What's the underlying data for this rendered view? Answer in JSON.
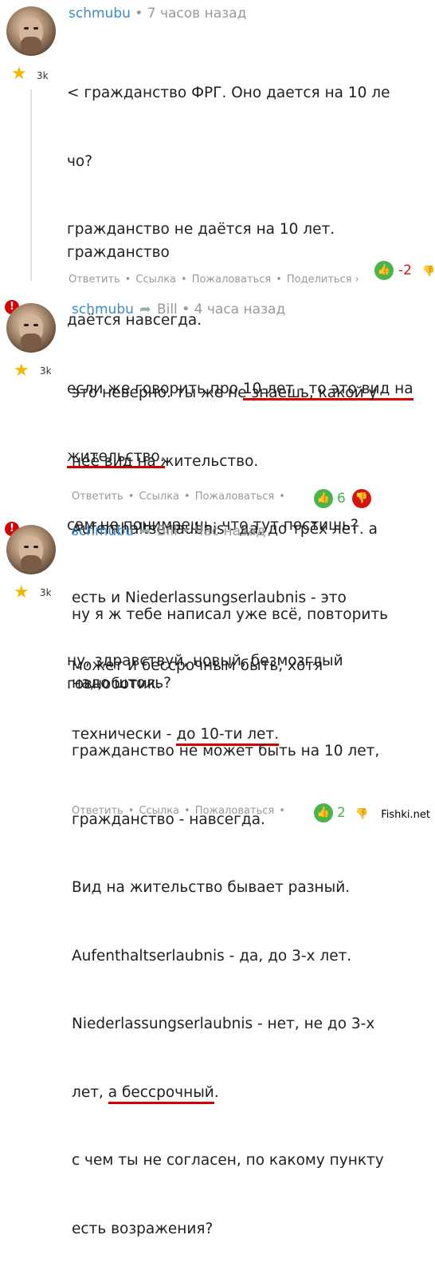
{
  "comments": [
    {
      "author": "schmubu",
      "time": "7 часов назад",
      "rating": "3k",
      "lines": [
        "< гражданство ФРГ. Оно дается на 10 ле",
        "чо?",
        "гражданство не даётся на 10 лет. гражданство",
        "даётся навсегда.",
        "если же говорить про ",
        "10-лет - то это вид на",
        "жительство.",
        "сам не понимаешь, что тут постишь?",
        "",
        "ну, здравствуй, новый, безмозглый говноботик."
      ],
      "actions": [
        "Ответить",
        "Ссылка",
        "Пожаловаться",
        "Поделиться ›"
      ],
      "score": "-2"
    },
    {
      "author": "schmubu",
      "reply_to": "Bill",
      "time": "4 часа назад",
      "rating": "3k",
      "lines": [
        "это неверно. ты же не знаешь, какой у",
        "неё вид на жительство.",
        "Aufenthaltserlaubnis - да, до трёх лет. а",
        "есть и Niederlassungserlaubnis - это",
        "может и бессрочным быть, хотя",
        "технически - ",
        "до 10-ти лет."
      ],
      "actions": [
        "Ответить",
        "Ссылка",
        "Пожаловаться"
      ],
      "score": "6"
    },
    {
      "author": "schmubu",
      "reply_to": "Bill",
      "time": "Час назад",
      "rating": "3k",
      "lines": [
        "ну я ж тебе написал уже всё, повторить",
        "надо штоль?",
        "гражданство не может быть на 10 лет,",
        "гражданство - навсегда.",
        "Вид на жительство бывает разный.",
        "Aufenthaltserlaubnis - да, до 3-х лет.",
        "Niederlassungserlaubnis - нет, не до 3-х",
        "лет, ",
        "а бессрочный",
        ".",
        "с чем ты не согласен, по какому пункту",
        "есть возражения?"
      ],
      "actions": [
        "Ответить",
        "Ссылка",
        "Пожаловаться"
      ],
      "score": "2"
    }
  ],
  "icons": {
    "like": "thumbs-up-icon",
    "dislike": "thumbs-down-icon",
    "star": "star-icon",
    "reply_arrow": "reply-arrow-icon",
    "alert": "alert-icon"
  },
  "alert_symbol": "!",
  "watermark": "Fishki.net",
  "colors": {
    "author": "#3a8bc6",
    "like": "#48b54b",
    "dislike": "#d61414",
    "underline": "#d30000",
    "star": "#f5b800"
  }
}
